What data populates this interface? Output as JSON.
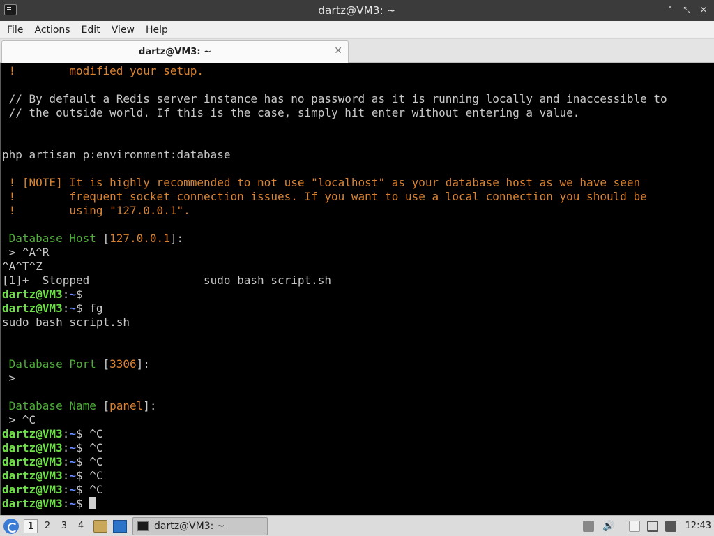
{
  "window": {
    "title": "dartz@VM3: ~",
    "controls": [
      "˅",
      "⤡",
      "✕"
    ]
  },
  "menu": [
    "File",
    "Actions",
    "Edit",
    "View",
    "Help"
  ],
  "tab": {
    "label": "dartz@VM3: ~",
    "close": "✕"
  },
  "terminal": {
    "lines": [
      [
        {
          "t": " !        modified your setup.",
          "c": "orange"
        }
      ],
      [
        {
          "t": ""
        }
      ],
      [
        {
          "t": " // By default a Redis server instance has no password as it is running locally and inaccessible to"
        }
      ],
      [
        {
          "t": " // the outside world. If this is the case, simply hit enter without entering a value."
        }
      ],
      [
        {
          "t": ""
        }
      ],
      [
        {
          "t": ""
        }
      ],
      [
        {
          "t": "php artisan p:environment:database"
        }
      ],
      [
        {
          "t": ""
        }
      ],
      [
        {
          "t": " ! [NOTE] It is highly recommended to not use \"localhost\" as your database host as we have seen",
          "c": "orange"
        }
      ],
      [
        {
          "t": " !        frequent socket connection issues. If you want to use a local connection you should be",
          "c": "orange"
        }
      ],
      [
        {
          "t": " !        using \"127.0.0.1\".",
          "c": "orange"
        }
      ],
      [
        {
          "t": ""
        }
      ],
      [
        {
          "t": " Database Host",
          "c": "dgreen"
        },
        {
          "t": " ["
        },
        {
          "t": "127.0.0.1",
          "c": "orange"
        },
        {
          "t": "]:"
        }
      ],
      [
        {
          "t": " > ^A^R"
        }
      ],
      [
        {
          "t": "^A^T^Z"
        }
      ],
      [
        {
          "t": "[1]+  Stopped                 sudo bash script.sh"
        }
      ],
      [
        {
          "t": "dartz@VM3",
          "c": "bgreen"
        },
        {
          "t": ":"
        },
        {
          "t": "~",
          "c": "bblue"
        },
        {
          "t": "$"
        }
      ],
      [
        {
          "t": "dartz@VM3",
          "c": "bgreen"
        },
        {
          "t": ":"
        },
        {
          "t": "~",
          "c": "bblue"
        },
        {
          "t": "$ fg"
        }
      ],
      [
        {
          "t": "sudo bash script.sh"
        }
      ],
      [
        {
          "t": ""
        }
      ],
      [
        {
          "t": ""
        }
      ],
      [
        {
          "t": " Database Port",
          "c": "dgreen"
        },
        {
          "t": " ["
        },
        {
          "t": "3306",
          "c": "orange"
        },
        {
          "t": "]:"
        }
      ],
      [
        {
          "t": " >"
        }
      ],
      [
        {
          "t": ""
        }
      ],
      [
        {
          "t": " Database Name",
          "c": "dgreen"
        },
        {
          "t": " ["
        },
        {
          "t": "panel",
          "c": "orange"
        },
        {
          "t": "]:"
        }
      ],
      [
        {
          "t": " > ^C"
        }
      ],
      [
        {
          "t": "dartz@VM3",
          "c": "bgreen"
        },
        {
          "t": ":"
        },
        {
          "t": "~",
          "c": "bblue"
        },
        {
          "t": "$ ^C"
        }
      ],
      [
        {
          "t": "dartz@VM3",
          "c": "bgreen"
        },
        {
          "t": ":"
        },
        {
          "t": "~",
          "c": "bblue"
        },
        {
          "t": "$ ^C"
        }
      ],
      [
        {
          "t": "dartz@VM3",
          "c": "bgreen"
        },
        {
          "t": ":"
        },
        {
          "t": "~",
          "c": "bblue"
        },
        {
          "t": "$ ^C"
        }
      ],
      [
        {
          "t": "dartz@VM3",
          "c": "bgreen"
        },
        {
          "t": ":"
        },
        {
          "t": "~",
          "c": "bblue"
        },
        {
          "t": "$ ^C"
        }
      ],
      [
        {
          "t": "dartz@VM3",
          "c": "bgreen"
        },
        {
          "t": ":"
        },
        {
          "t": "~",
          "c": "bblue"
        },
        {
          "t": "$ ^C"
        }
      ],
      [
        {
          "t": "dartz@VM3",
          "c": "bgreen"
        },
        {
          "t": ":"
        },
        {
          "t": "~",
          "c": "bblue"
        },
        {
          "t": "$ "
        },
        {
          "cursor": true
        }
      ]
    ]
  },
  "taskbar": {
    "workspaces": [
      "1",
      "2",
      "3",
      "4"
    ],
    "active_workspace": "1",
    "task": {
      "label": "dartz@VM3: ~",
      "icon": "terminal-icon"
    },
    "clock": "12:43",
    "icons": [
      "menu-icon",
      "file-manager-icon",
      "show-desktop-icon",
      "volume-icon",
      "clipboard-icon",
      "network-icon",
      "notifications-icon"
    ]
  },
  "colors": {
    "orange": "#d98231",
    "prompt_user": "#6ce046",
    "prompt_path": "#6b8cff",
    "prompt_label": "#4fae3a",
    "terminal_bg": "#000000",
    "titlebar_bg": "#3b3b3b"
  }
}
